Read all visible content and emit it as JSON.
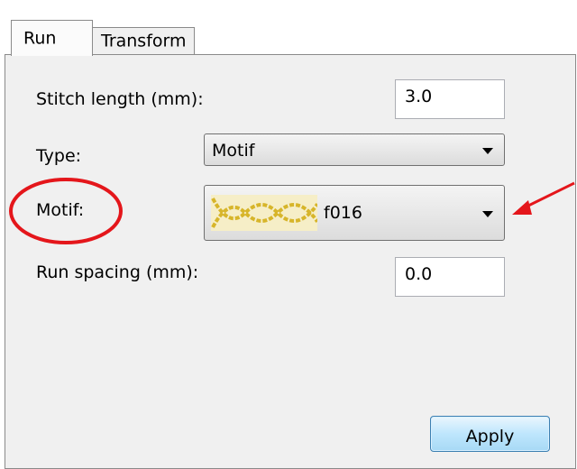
{
  "tabs": [
    {
      "label": "Run",
      "active": true
    },
    {
      "label": "Transform",
      "active": false
    }
  ],
  "form": {
    "stitch_length_label": "Stitch length (mm):",
    "stitch_length_value": "3.0",
    "type_label": "Type:",
    "type_value": "Motif",
    "motif_label": "Motif:",
    "motif_value": "f016",
    "run_spacing_label": "Run spacing (mm):",
    "run_spacing_value": "0.0",
    "apply_label": "Apply"
  },
  "colors": {
    "highlight": "#e4161b",
    "motif_pattern": "#d7b52a",
    "apply_button": "#bee6fd"
  },
  "icons": [
    "chevron-down-icon",
    "motif-preview-icon",
    "highlight-circle",
    "pointer-arrow"
  ]
}
